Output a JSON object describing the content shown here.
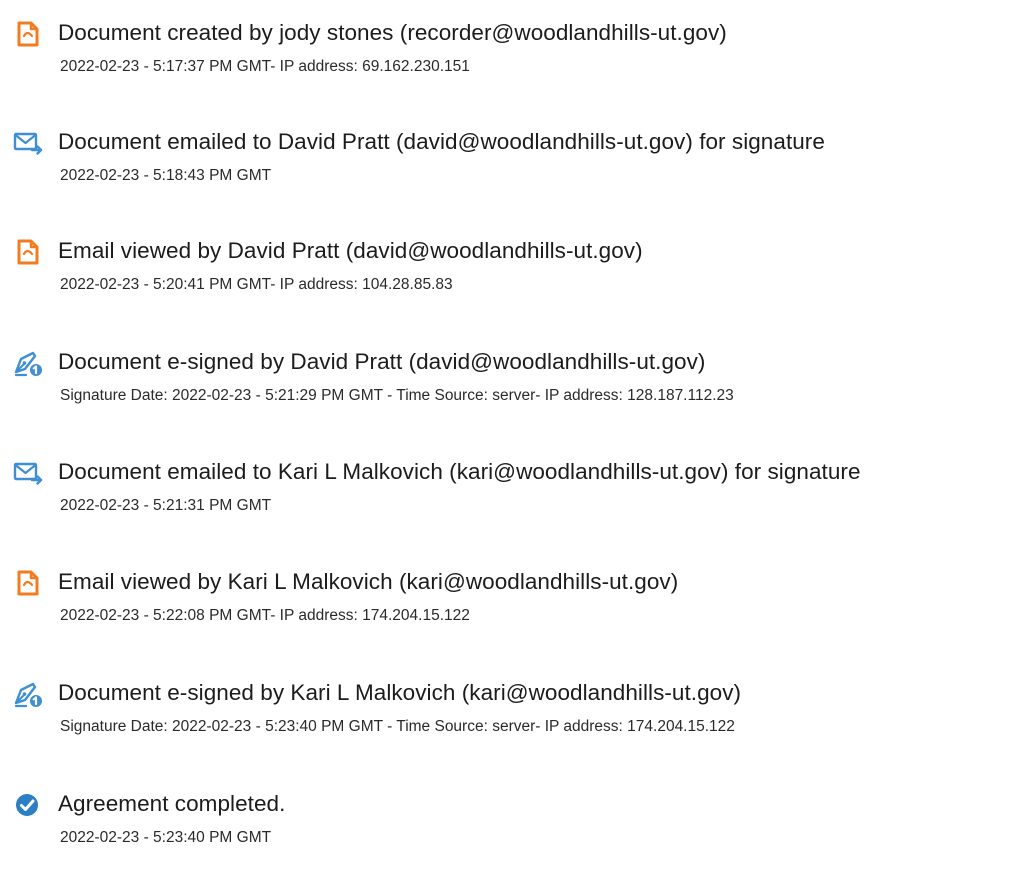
{
  "colors": {
    "doc_icon": "#f47b20",
    "mail_icon": "#3f8fd2",
    "sign_icon": "#3f8fd2",
    "check_icon": "#2b7fc4",
    "text": "#1c1c1c"
  },
  "events": [
    {
      "icon": "document-icon",
      "title": "Document created by jody stones (recorder@woodlandhills-ut.gov)",
      "detail": "2022-02-23 - 5:17:37 PM GMT- IP address: 69.162.230.151"
    },
    {
      "icon": "email-sent-icon",
      "title": "Document emailed to David Pratt (david@woodlandhills-ut.gov) for signature",
      "detail": "2022-02-23 - 5:18:43 PM GMT"
    },
    {
      "icon": "document-icon",
      "title": "Email viewed by David Pratt (david@woodlandhills-ut.gov)",
      "detail": "2022-02-23 - 5:20:41 PM GMT- IP address: 104.28.85.83"
    },
    {
      "icon": "esign-pen-icon",
      "title": "Document e-signed by David Pratt (david@woodlandhills-ut.gov)",
      "detail": "Signature Date: 2022-02-23 - 5:21:29 PM GMT - Time Source: server- IP address: 128.187.112.23"
    },
    {
      "icon": "email-sent-icon",
      "title": "Document emailed to Kari L Malkovich (kari@woodlandhills-ut.gov) for signature",
      "detail": "2022-02-23 - 5:21:31 PM GMT"
    },
    {
      "icon": "document-icon",
      "title": "Email viewed by Kari L Malkovich (kari@woodlandhills-ut.gov)",
      "detail": "2022-02-23 - 5:22:08 PM GMT- IP address: 174.204.15.122"
    },
    {
      "icon": "esign-pen-icon",
      "title": "Document e-signed by Kari L Malkovich (kari@woodlandhills-ut.gov)",
      "detail": "Signature Date: 2022-02-23 - 5:23:40 PM GMT - Time Source: server- IP address: 174.204.15.122"
    },
    {
      "icon": "check-circle-icon",
      "title": "Agreement completed.",
      "detail": "2022-02-23 - 5:23:40 PM GMT"
    }
  ]
}
